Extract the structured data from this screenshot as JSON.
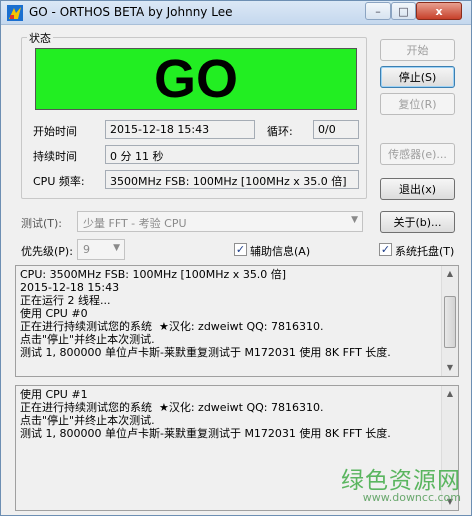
{
  "window": {
    "title": "GO - ORTHOS BETA by Johnny Lee",
    "icon": "orthos-app-icon",
    "controls": {
      "minimize": "–",
      "maximize": "□",
      "close": "x"
    }
  },
  "status_group": {
    "label": "状态",
    "big_status": "GO",
    "big_status_color": "#22ee22",
    "start_time_label": "开始时间",
    "start_time_value": "2015-12-18 15:43",
    "loop_label": "循环:",
    "loop_value": "0/0",
    "duration_label": "持续时间",
    "duration_value": "0 分 11 秒",
    "cpu_freq_label": "CPU 频率:",
    "cpu_freq_value": "3500MHz FSB: 100MHz [100MHz x 35.0 倍]"
  },
  "buttons": {
    "start": "开始",
    "stop": "停止(S)",
    "reset": "复位(R)",
    "sensors": "传感器(e)...",
    "exit": "退出(x)",
    "about": "关于(b)..."
  },
  "test": {
    "label": "测试(T):",
    "selected": "少量 FFT - 考验 CPU"
  },
  "priority": {
    "label": "优先级(P):",
    "selected": "9"
  },
  "checkboxes": {
    "aux_info": {
      "label": "辅助信息(A)",
      "checked": true
    },
    "tray": {
      "label": "系统托盘(T)",
      "checked": true
    }
  },
  "log1": {
    "lines": [
      "CPU: 3500MHz FSB: 100MHz [100MHz x 35.0 倍]",
      "2015-12-18 15:43",
      "正在运行 2 线程...",
      "使用 CPU #0",
      "正在进行持续测试您的系统  ★汉化: zdweiwt QQ: 7816310.",
      "点击\"停止\"并终止本次测试.",
      "测试 1, 800000 单位卢卡斯-莱默重复测试于 M172031 使用 8K FFT 长度."
    ]
  },
  "log2": {
    "lines": [
      "使用 CPU #1",
      "正在进行持续测试您的系统  ★汉化: zdweiwt QQ: 7816310.",
      "点击\"停止\"并终止本次测试.",
      "测试 1, 800000 单位卢卡斯-莱默重复测试于 M172031 使用 8K FFT 长度."
    ]
  },
  "watermark": {
    "text": "绿色资源网",
    "url": "www.downcc.com"
  }
}
